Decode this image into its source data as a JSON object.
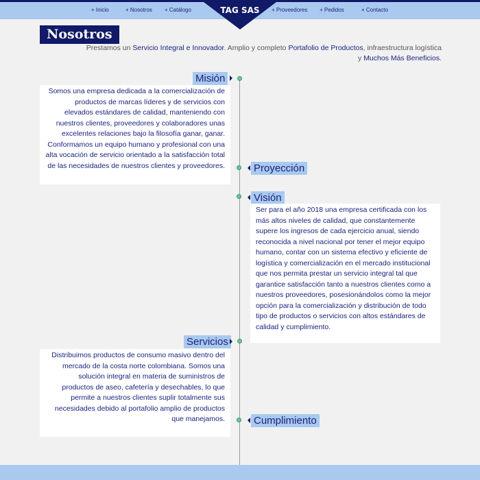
{
  "nav": {
    "items": [
      "+ Inicio",
      "+ Nosotros",
      "+ Catálogo",
      "+ Proveedores",
      "+ Pedidos",
      "+ Contacto"
    ],
    "logo": "TAG SAS"
  },
  "page_title": "Nosotros",
  "intro": {
    "t1": "Prestamos un ",
    "h1": "Servicio Integral e Innovador",
    "t2": ". Amplio y completo ",
    "h2": "Portafolio de Productos",
    "t3": ", infraestructura logística y ",
    "h3": "Muchos Más Beneficios",
    "t4": "."
  },
  "timeline": {
    "mision": {
      "label": "Misión",
      "text": "Somos una empresa dedicada a la comercialización de productos de marcas líderes y de servicios con elevados estándares de calidad, manteniendo con nuestros clientes, proveedores y colaboradores unas excelentes relaciones bajo la filosofía ganar, ganar. Conformamos un equipo humano y profesional con una alta vocación de servicio orientado a la satisfacción total de las necesidades de nuestros clientes y proveedores."
    },
    "proyeccion": {
      "label": "Proyección"
    },
    "vision": {
      "label": "Visión",
      "text": "Ser para el año 2018 una empresa certificada con los más altos niveles de calidad, que constantemente supere los ingresos de cada ejercicio anual, siendo reconocida a nivel nacional por tener el mejor equipo humano, contar con un sistema efectivo y eficiente de logística y comercialización en el mercado institucional que nos permita prestar un servicio integral tal que garantice satisfacción tanto a nuestros clientes como a nuestros proveedores, posesionándolos como la mejor opción para la comercialización y distribución de todo tipo de productos o servicios con altos estándares de calidad y cumplimiento."
    },
    "servicios": {
      "label": "Servicios",
      "text": "Distribuimos productos de consumo masivo dentro del mercado de la costa norte colombiana. Somos una solución integral en materia de suministros de productos de aseo, cafetería y desechables, lo que permite a nuestros clientes suplir totalmente sus necesidades debido al portafolio amplio de productos que manejamos."
    },
    "cumplimiento": {
      "label": "Cumplimiento"
    }
  }
}
